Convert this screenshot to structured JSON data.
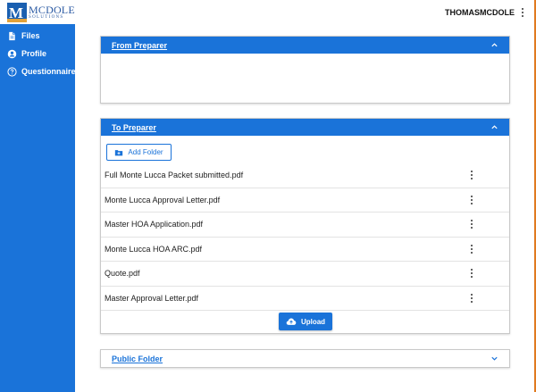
{
  "brand": {
    "logo_text": "MCDOLE",
    "logo_subtext": "SOLUTIONS",
    "logo_letter": "M"
  },
  "sidebar": {
    "items": [
      {
        "label": "Files",
        "icon": "file-icon"
      },
      {
        "label": "Profile",
        "icon": "user-circle-icon"
      },
      {
        "label": "Questionnaire",
        "icon": "help-circle-icon"
      }
    ]
  },
  "header": {
    "username": "THOMASMCDOLE"
  },
  "panels": {
    "from_preparer": {
      "title": "From Preparer",
      "state": "expanded"
    },
    "to_preparer": {
      "title": "To Preparer",
      "state": "expanded",
      "add_folder_label": "Add Folder",
      "upload_label": "Upload",
      "files": [
        "Full Monte Lucca Packet submitted.pdf",
        "Monte Lucca Approval Letter.pdf",
        "Master HOA Application.pdf",
        "Monte Lucca HOA ARC.pdf",
        "Quote.pdf",
        "Master Approval Letter.pdf"
      ]
    },
    "public_folder": {
      "title": "Public Folder",
      "state": "collapsed"
    }
  },
  "colors": {
    "primary": "#1a73d9",
    "window_edge": "#e07a1f",
    "logo_accent": "#e2a23a"
  }
}
